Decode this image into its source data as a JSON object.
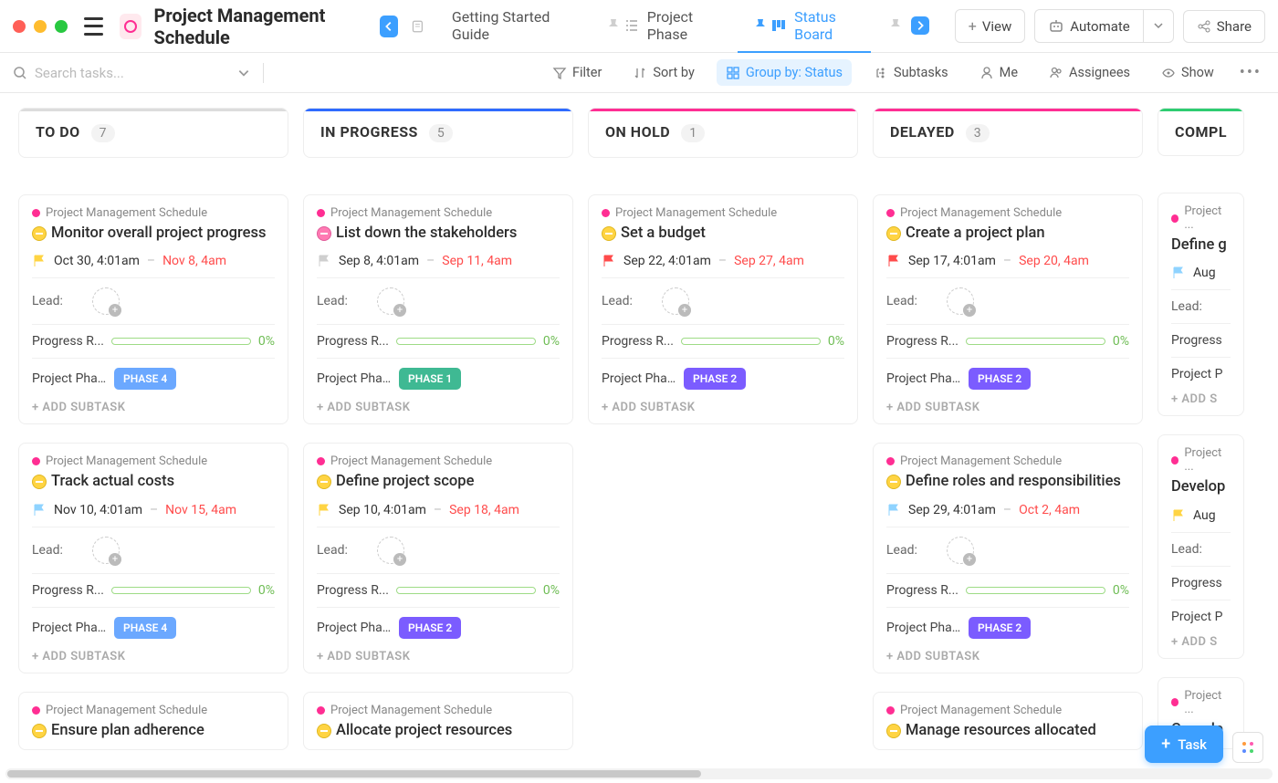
{
  "header": {
    "project_title": "Project Management Schedule",
    "getting_started": "Getting Started Guide",
    "tab_phase": "Project Phase",
    "tab_status": "Status Board",
    "view_btn": "View",
    "automate_btn": "Automate",
    "share_btn": "Share"
  },
  "toolbar": {
    "search_placeholder": "Search tasks...",
    "filter": "Filter",
    "sort": "Sort by",
    "group": "Group by: Status",
    "subtasks": "Subtasks",
    "me": "Me",
    "assignees": "Assignees",
    "show": "Show"
  },
  "labels": {
    "lead": "Lead:",
    "progress": "Progress R...",
    "phase": "Project Pha...",
    "add_subtask": "+ ADD SUBTASK",
    "add_s_short": "+ ADD S",
    "crumb": "Project Management Schedule",
    "crumb_short": "Project ..."
  },
  "columns": [
    {
      "id": "todo",
      "title": "TO DO",
      "count": "7",
      "cls": "col-todo",
      "cards": [
        {
          "status": "yellow",
          "title": "Monitor overall project progress",
          "flag": "#ffd443",
          "start": "Oct 30, 4:01am",
          "due": "Nov 8, 4am",
          "progress": "0%",
          "phase": "PHASE 4",
          "phase_cls": "ph4"
        },
        {
          "status": "yellow",
          "title": "Track actual costs",
          "flag": "#8fd3ff",
          "start": "Nov 10, 4:01am",
          "due": "Nov 15, 4am",
          "progress": "0%",
          "phase": "PHASE 4",
          "phase_cls": "ph4"
        },
        {
          "status": "yellow",
          "title": "Ensure plan adherence",
          "partial": true
        }
      ]
    },
    {
      "id": "prog",
      "title": "IN PROGRESS",
      "count": "5",
      "cls": "col-prog",
      "cards": [
        {
          "status": "pink",
          "title": "List down the stakeholders",
          "flag": "#cfcfcf",
          "start": "Sep 8, 4:01am",
          "due": "Sep 11, 4am",
          "progress": "0%",
          "phase": "PHASE 1",
          "phase_cls": "ph1"
        },
        {
          "status": "yellow",
          "title": "Define project scope",
          "flag": "#ffd443",
          "start": "Sep 10, 4:01am",
          "due": "Sep 18, 4am",
          "progress": "0%",
          "phase": "PHASE 2",
          "phase_cls": "ph2"
        },
        {
          "status": "yellow",
          "title": "Allocate project resources",
          "partial": true
        }
      ]
    },
    {
      "id": "hold",
      "title": "ON HOLD",
      "count": "1",
      "cls": "col-hold",
      "cards": [
        {
          "status": "yellow",
          "title": "Set a budget",
          "flag": "#ff4b4b",
          "start": "Sep 22, 4:01am",
          "due": "Sep 27, 4am",
          "progress": "0%",
          "phase": "PHASE 2",
          "phase_cls": "ph2"
        }
      ]
    },
    {
      "id": "del",
      "title": "DELAYED",
      "count": "3",
      "cls": "col-del",
      "cards": [
        {
          "status": "yellow",
          "title": "Create a project plan",
          "flag": "#ff4b4b",
          "start": "Sep 17, 4:01am",
          "due": "Sep 20, 4am",
          "progress": "0%",
          "phase": "PHASE 2",
          "phase_cls": "ph2"
        },
        {
          "status": "yellow",
          "title": "Define roles and responsibilities",
          "flag": "#8fd3ff",
          "start": "Sep 29, 4:01am",
          "due": "Oct 2, 4am",
          "progress": "0%",
          "phase": "PHASE 2",
          "phase_cls": "ph2"
        },
        {
          "status": "yellow",
          "title": "Manage resources allocated",
          "partial": true
        }
      ]
    },
    {
      "id": "comp",
      "title": "COMPL",
      "count": "",
      "cls": "col-comp",
      "cards": [
        {
          "title": "Define g",
          "flag": "#8fd3ff",
          "start": "Aug",
          "short": true
        },
        {
          "title": "Develop",
          "flag": "#ffd443",
          "start": "Aug",
          "short": true
        },
        {
          "title": "Comple",
          "short": true,
          "partial": true
        }
      ]
    }
  ],
  "fab": {
    "label": "Task"
  }
}
